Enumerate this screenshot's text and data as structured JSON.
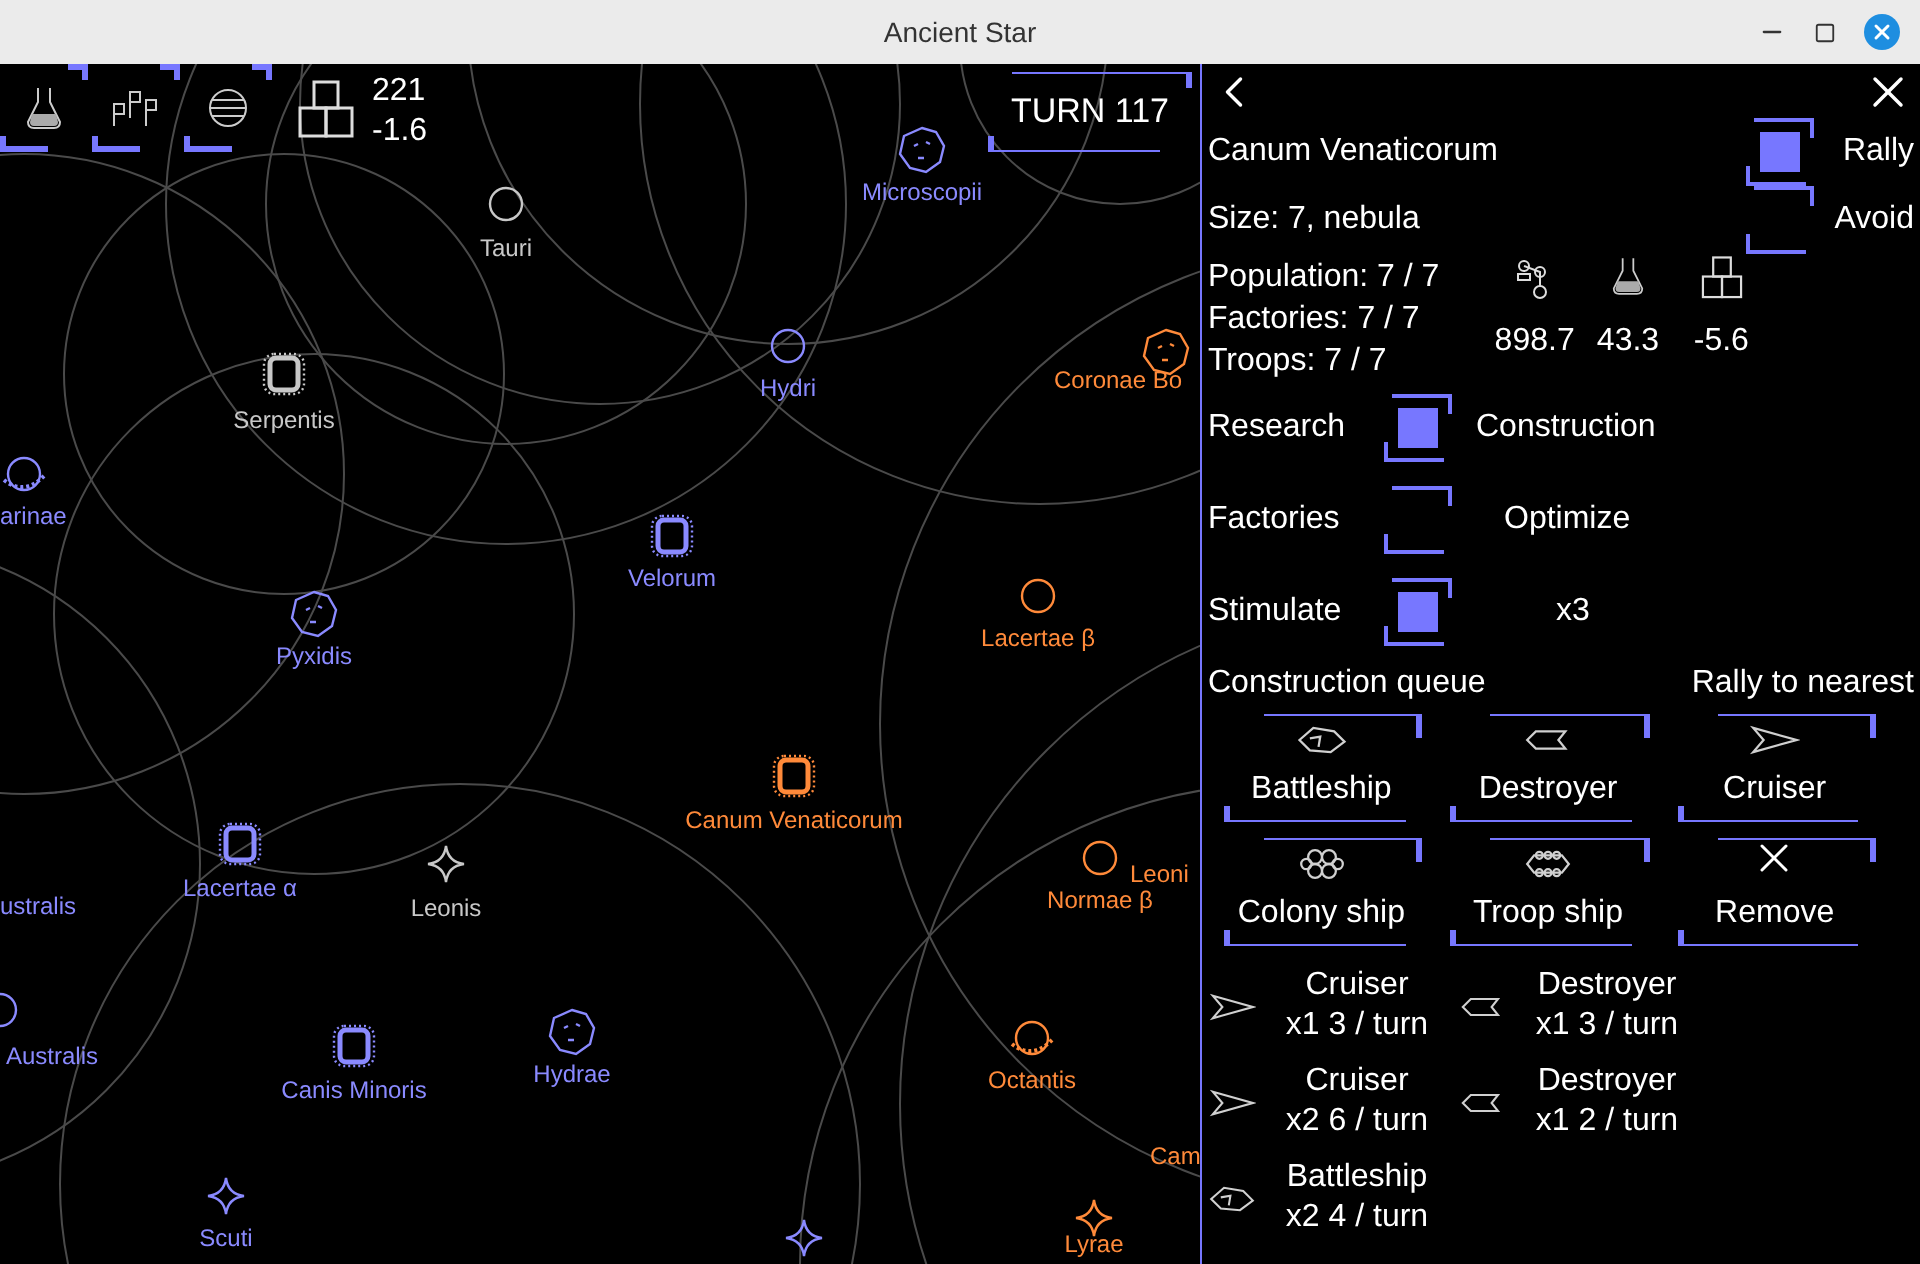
{
  "window": {
    "title": "Ancient Star"
  },
  "hud": {
    "production": "221",
    "delta": "-1.6",
    "turn_button": "TURN 117"
  },
  "map": {
    "systems": [
      {
        "name": "Tauri",
        "color": "#c8c8c8",
        "kind": "ring"
      },
      {
        "name": "Microscopii",
        "color": "#8a8aff",
        "kind": "blob"
      },
      {
        "name": "Serpentis",
        "color": "#c8c8c8",
        "kind": "nebula"
      },
      {
        "name": "Hydri",
        "color": "#8a8aff",
        "kind": "ring"
      },
      {
        "name": "Coronae Bo",
        "color": "#ff8a3a",
        "kind": "blob"
      },
      {
        "name": "arinae",
        "color": "#8a8aff",
        "kind": "dotted"
      },
      {
        "name": "Velorum",
        "color": "#8a8aff",
        "kind": "nebula"
      },
      {
        "name": "Pyxidis",
        "color": "#8a8aff",
        "kind": "blob"
      },
      {
        "name": "Lacertae β",
        "color": "#ff8a3a",
        "kind": "ring"
      },
      {
        "name": "Canum Venaticorum",
        "color": "#ff8a3a",
        "kind": "nebula"
      },
      {
        "name": "Lacertae α",
        "color": "#8a8aff",
        "kind": "nebula"
      },
      {
        "name": "ustralis",
        "color": "#8a8aff",
        "kind": "none"
      },
      {
        "name": "Leonis",
        "color": "#c8c8c8",
        "kind": "sparkle"
      },
      {
        "name": "Leoni",
        "color": "#ff8a3a",
        "kind": "none"
      },
      {
        "name": "Normae β",
        "color": "#ff8a3a",
        "kind": "ring"
      },
      {
        "name": "Australis",
        "color": "#8a8aff",
        "kind": "ring"
      },
      {
        "name": "Canis Minoris",
        "color": "#8a8aff",
        "kind": "nebula"
      },
      {
        "name": "Hydrae",
        "color": "#8a8aff",
        "kind": "blob"
      },
      {
        "name": "Octantis",
        "color": "#ff8a3a",
        "kind": "dotted"
      },
      {
        "name": "Cam",
        "color": "#ff8a3a",
        "kind": "none"
      },
      {
        "name": "Scuti",
        "color": "#8a8aff",
        "kind": "sparkle"
      },
      {
        "color": "#8a8aff",
        "kind": "sparkle"
      },
      {
        "name": "Lyrae",
        "color": "#ff8a3a",
        "kind": "sparkle"
      }
    ]
  },
  "panel": {
    "title": "Canum Venaticorum",
    "rally": {
      "label": "Rally",
      "checked": true
    },
    "avoid": {
      "label": "Avoid",
      "checked": false
    },
    "size": "Size: 7, nebula",
    "population": "Population: 7 / 7",
    "factories": "Factories: 7 / 7",
    "troops": "Troops: 7 / 7",
    "stats": [
      "898.7",
      "43.3",
      "-5.6"
    ],
    "toggles": [
      {
        "label": "Research",
        "option": "Construction",
        "checked": true
      },
      {
        "label": "Factories",
        "option": "Optimize",
        "checked": false
      },
      {
        "label": "Stimulate",
        "option": "x3",
        "checked": true
      }
    ],
    "queue_title": "Construction queue",
    "rally_button": "Rally to nearest",
    "build_buttons": [
      {
        "label": "Battleship",
        "kind": "battleship"
      },
      {
        "label": "Destroyer",
        "kind": "destroyer"
      },
      {
        "label": "Cruiser",
        "kind": "cruiser"
      },
      {
        "label": "Colony ship",
        "kind": "colony"
      },
      {
        "label": "Troop ship",
        "kind": "troop"
      },
      {
        "label": "Remove",
        "kind": "remove"
      }
    ],
    "queue": [
      {
        "name": "Cruiser",
        "detail": "x1 3 / turn",
        "kind": "cruiser"
      },
      {
        "name": "Destroyer",
        "detail": "x1 3 / turn",
        "kind": "destroyer"
      },
      {
        "name": "Cruiser",
        "detail": "x2 6 / turn",
        "kind": "cruiser"
      },
      {
        "name": "Destroyer",
        "detail": "x1 2 / turn",
        "kind": "destroyer"
      },
      {
        "name": "Battleship",
        "detail": "x2 4 / turn",
        "kind": "battleship"
      }
    ]
  }
}
